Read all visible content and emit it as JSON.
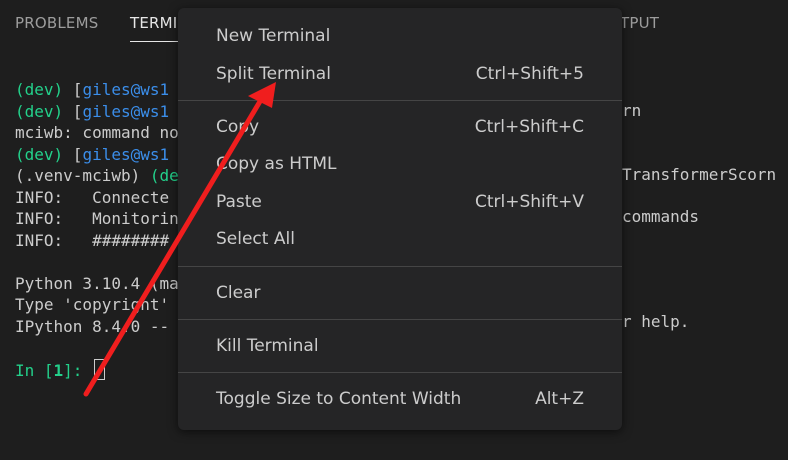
{
  "tabs": {
    "problems": "PROBLEMS",
    "terminal": "TERMI",
    "output": "TPUT"
  },
  "terminal": {
    "lines": [
      {
        "parts": [
          {
            "t": "(dev) ",
            "c": "green"
          },
          {
            "t": "[",
            "c": ""
          },
          {
            "t": "giles@ws1",
            "c": "blue"
          }
        ]
      },
      {
        "parts": [
          {
            "t": "(dev) ",
            "c": "green"
          },
          {
            "t": "[",
            "c": ""
          },
          {
            "t": "giles@ws1",
            "c": "blue"
          }
        ]
      },
      {
        "parts": [
          {
            "t": "mciwb: command no",
            "c": ""
          }
        ]
      },
      {
        "parts": [
          {
            "t": "(dev) ",
            "c": "green"
          },
          {
            "t": "[",
            "c": ""
          },
          {
            "t": "giles@ws1",
            "c": "blue"
          }
        ]
      },
      {
        "parts": [
          {
            "t": "(.venv-mciwb) ",
            "c": ""
          },
          {
            "t": "(de",
            "c": "green"
          }
        ]
      },
      {
        "parts": [
          {
            "t": "INFO:   Connecte",
            "c": ""
          }
        ]
      },
      {
        "parts": [
          {
            "t": "INFO:   Monitorin",
            "c": ""
          }
        ]
      },
      {
        "parts": [
          {
            "t": "INFO:   ########",
            "c": ""
          }
        ]
      },
      {
        "parts": [
          {
            "t": "",
            "c": ""
          }
        ]
      },
      {
        "parts": [
          {
            "t": "Python 3.10.4 (ma",
            "c": ""
          }
        ]
      },
      {
        "parts": [
          {
            "t": "Type 'copyright'",
            "c": ""
          }
        ]
      },
      {
        "parts": [
          {
            "t": "IPython 8.4.0 --",
            "c": ""
          }
        ]
      },
      {
        "parts": [
          {
            "t": "",
            "c": ""
          }
        ]
      },
      {
        "parts": [
          {
            "t": "In [",
            "c": "green"
          },
          {
            "t": "1",
            "c": "green-bold"
          },
          {
            "t": "]: ",
            "c": "green"
          }
        ]
      }
    ],
    "right_fragments": {
      "l2": "rn",
      "l5": "TransformerScorn",
      "l7": "commands",
      "l12": "r help."
    }
  },
  "context_menu": {
    "items": [
      {
        "label": "New Terminal",
        "shortcut": ""
      },
      {
        "label": "Split Terminal",
        "shortcut": "Ctrl+Shift+5"
      },
      {
        "label": "Copy",
        "shortcut": "Ctrl+Shift+C"
      },
      {
        "label": "Copy as HTML",
        "shortcut": ""
      },
      {
        "label": "Paste",
        "shortcut": "Ctrl+Shift+V"
      },
      {
        "label": "Select All",
        "shortcut": ""
      },
      {
        "label": "Clear",
        "shortcut": ""
      },
      {
        "label": "Kill Terminal",
        "shortcut": ""
      },
      {
        "label": "Toggle Size to Content Width",
        "shortcut": "Alt+Z"
      }
    ]
  },
  "colors": {
    "background": "#1e1e1e",
    "menu_background": "#252526",
    "menu_text": "#cccccc",
    "terminal_green": "#23d18b",
    "terminal_blue": "#3b8eea",
    "annotation_arrow": "#f01e1e"
  }
}
